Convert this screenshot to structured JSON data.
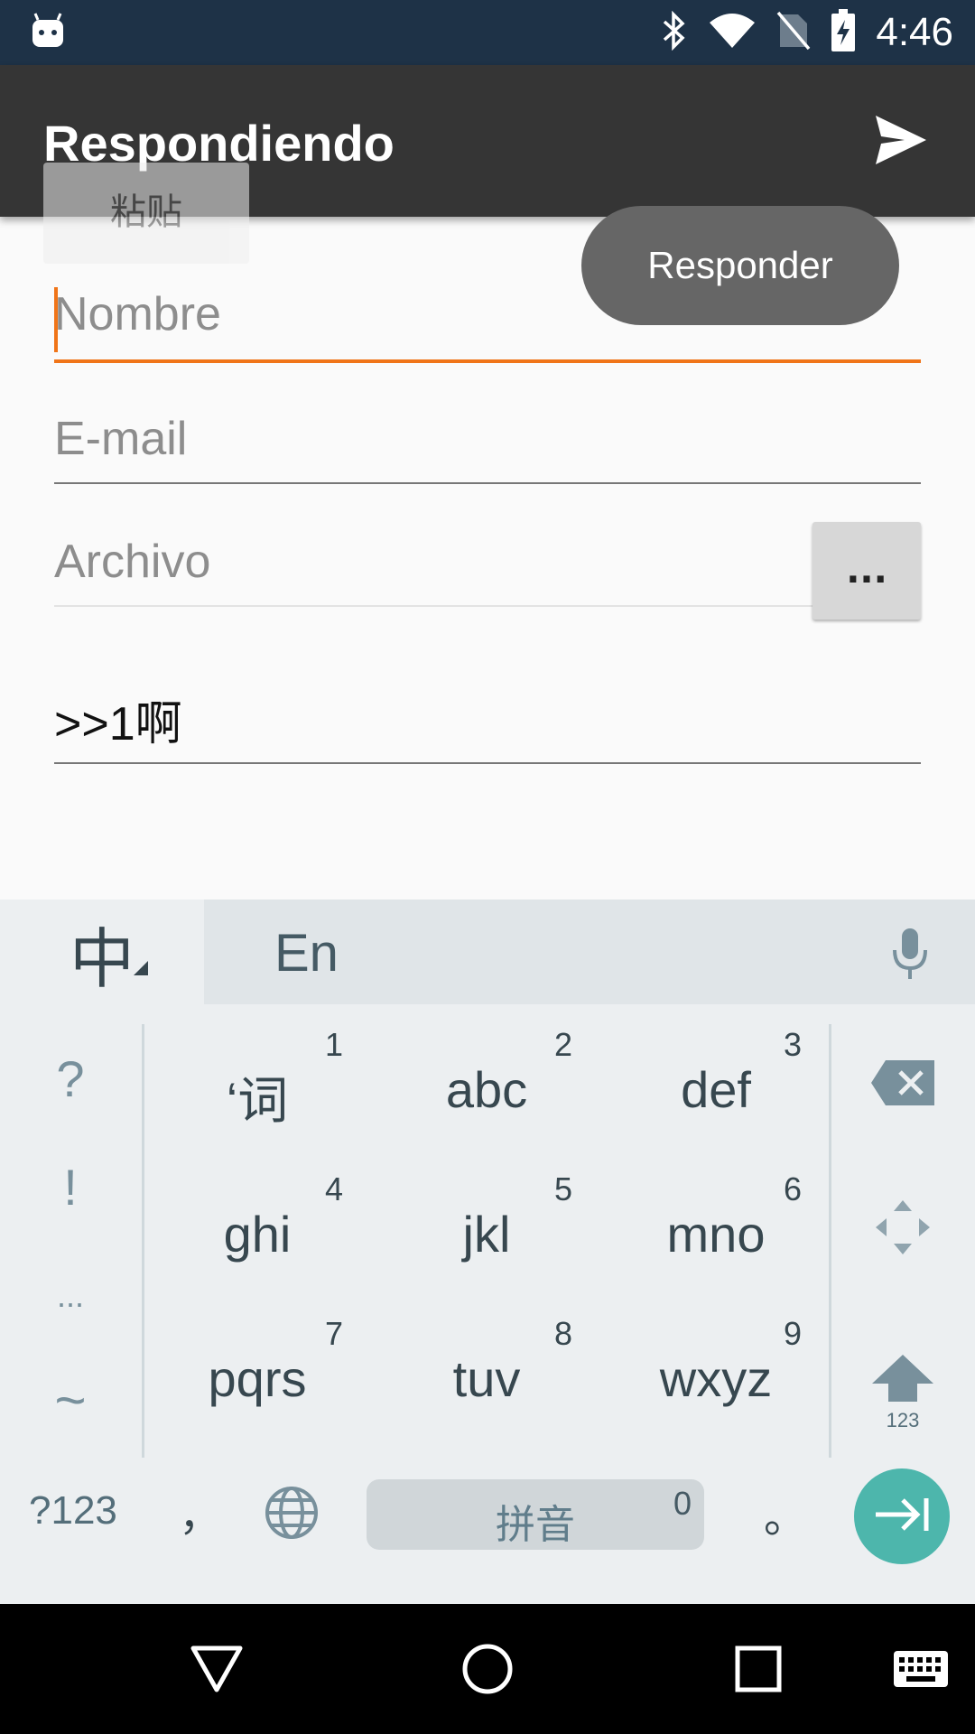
{
  "status_bar": {
    "time": "4:46",
    "icons": [
      "android-robot-icon",
      "bluetooth-icon",
      "wifi-icon",
      "no-sim-icon",
      "battery-charging-icon"
    ]
  },
  "app_bar": {
    "title": "Respondiendo",
    "action_icon": "send-icon"
  },
  "paste_popup": {
    "label": "粘贴"
  },
  "toast": {
    "text": "Responder"
  },
  "form": {
    "name": {
      "placeholder": "Nombre",
      "value": ""
    },
    "email": {
      "placeholder": "E-mail",
      "value": ""
    },
    "file": {
      "placeholder": "Archivo",
      "value": "",
      "browse_label": "..."
    },
    "message": {
      "value": ">>1啊"
    }
  },
  "keyboard": {
    "language_key": "中",
    "candidate_text": "En",
    "mic_icon": "microphone-icon",
    "left_symbols": [
      "?",
      "!",
      "...",
      "~"
    ],
    "keys": [
      {
        "label": "‘词",
        "num": "1"
      },
      {
        "label": "abc",
        "num": "2"
      },
      {
        "label": "def",
        "num": "3"
      },
      {
        "label": "ghi",
        "num": "4"
      },
      {
        "label": "jkl",
        "num": "5"
      },
      {
        "label": "mno",
        "num": "6"
      },
      {
        "label": "pqrs",
        "num": "7"
      },
      {
        "label": "tuv",
        "num": "8"
      },
      {
        "label": "wxyz",
        "num": "9"
      }
    ],
    "right_keys": {
      "backspace_icon": "backspace-icon",
      "cursor_icon": "cursor-move-icon",
      "shift_icon": "shift-icon",
      "shift_label": "123"
    },
    "bottom_row": {
      "symbols": "?123",
      "comma": "，",
      "globe_icon": "globe-icon",
      "space_label": "拼音",
      "space_num": "0",
      "period": "。",
      "enter_icon": "next-field-icon"
    }
  },
  "nav_bar": {
    "icons": [
      "back-icon",
      "home-icon",
      "recents-icon",
      "keyboard-icon"
    ]
  }
}
